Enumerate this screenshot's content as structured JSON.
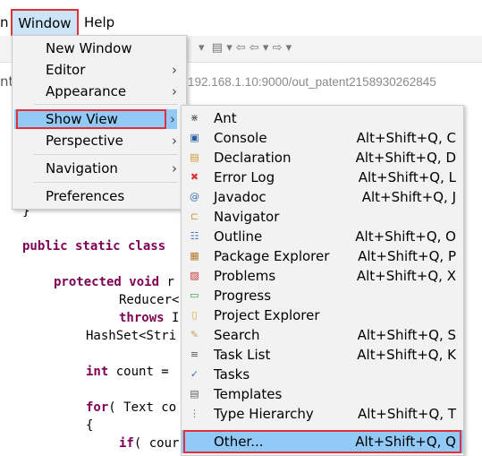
{
  "menubar": {
    "items": [
      "n",
      "Window",
      "Help"
    ]
  },
  "address": "192.168.1.10:9000/out_patent2158930262845",
  "left_fragment": "nt",
  "window_menu": [
    {
      "label": "New Window"
    },
    {
      "label": "Editor",
      "submenu": true
    },
    {
      "label": "Appearance",
      "submenu": true
    },
    {
      "label": "Show View",
      "submenu": true,
      "highlighted": true
    },
    {
      "label": "Perspective",
      "submenu": true
    },
    {
      "label": "Navigation",
      "submenu": true
    },
    {
      "label": "Preferences"
    }
  ],
  "show_view_menu": [
    {
      "label": "Ant",
      "shortcut": "",
      "icon": "ant-icon"
    },
    {
      "label": "Console",
      "shortcut": "Alt+Shift+Q, C",
      "icon": "console-icon"
    },
    {
      "label": "Declaration",
      "shortcut": "Alt+Shift+Q, D",
      "icon": "declaration-icon"
    },
    {
      "label": "Error Log",
      "shortcut": "Alt+Shift+Q, L",
      "icon": "error-log-icon"
    },
    {
      "label": "Javadoc",
      "shortcut": "Alt+Shift+Q, J",
      "icon": "javadoc-icon"
    },
    {
      "label": "Navigator",
      "shortcut": "",
      "icon": "navigator-icon"
    },
    {
      "label": "Outline",
      "shortcut": "Alt+Shift+Q, O",
      "icon": "outline-icon"
    },
    {
      "label": "Package Explorer",
      "shortcut": "Alt+Shift+Q, P",
      "icon": "package-explorer-icon"
    },
    {
      "label": "Problems",
      "shortcut": "Alt+Shift+Q, X",
      "icon": "problems-icon"
    },
    {
      "label": "Progress",
      "shortcut": "",
      "icon": "progress-icon"
    },
    {
      "label": "Project Explorer",
      "shortcut": "",
      "icon": "project-explorer-icon"
    },
    {
      "label": "Search",
      "shortcut": "Alt+Shift+Q, S",
      "icon": "search-icon"
    },
    {
      "label": "Task List",
      "shortcut": "Alt+Shift+Q, K",
      "icon": "task-list-icon"
    },
    {
      "label": "Tasks",
      "shortcut": "",
      "icon": "tasks-icon"
    },
    {
      "label": "Templates",
      "shortcut": "",
      "icon": "templates-icon"
    },
    {
      "label": "Type Hierarchy",
      "shortcut": "Alt+Shift+Q, T",
      "icon": "type-hierarchy-icon"
    },
    {
      "label": "Other...",
      "shortcut": "Alt+Shift+Q, Q",
      "highlighted": true
    }
  ],
  "code": {
    "l1": "}",
    "l2a": "public static class",
    "l3a": "protected void",
    "l3b": " r",
    "l4": "Reducer<",
    "l5a": "throws",
    "l5b": " I",
    "l6": "HashSet<Stri",
    "l7a": "int",
    "l7b": " count =",
    "l8a": "for",
    "l8b": "( Text co",
    "l9": "{",
    "l10a": "if",
    "l10b": "( cour"
  }
}
